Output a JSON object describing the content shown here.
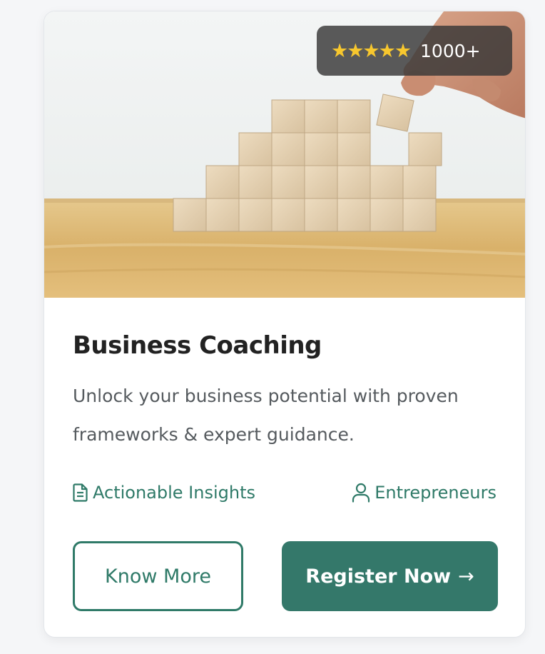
{
  "card": {
    "image_description_icon": "wooden-blocks-photo",
    "rating": {
      "stars": "★★★★★",
      "value": 5,
      "count": "1000+"
    },
    "title": "Business Coaching",
    "description": "Unlock your business potential with proven frameworks & expert guidance.",
    "meta": {
      "left": {
        "icon": "document-icon",
        "label": "Actionable Insights"
      },
      "right": {
        "icon": "user-icon",
        "label": "Entrepreneurs"
      }
    },
    "buttons": {
      "secondary_label": "Know More",
      "primary_label": "Register Now",
      "primary_arrow": "→"
    }
  },
  "colors": {
    "accent": "#34786a",
    "accent_text": "#2f7a68",
    "star": "#f7c72e",
    "title": "#222222",
    "body_text": "#555a5e"
  }
}
